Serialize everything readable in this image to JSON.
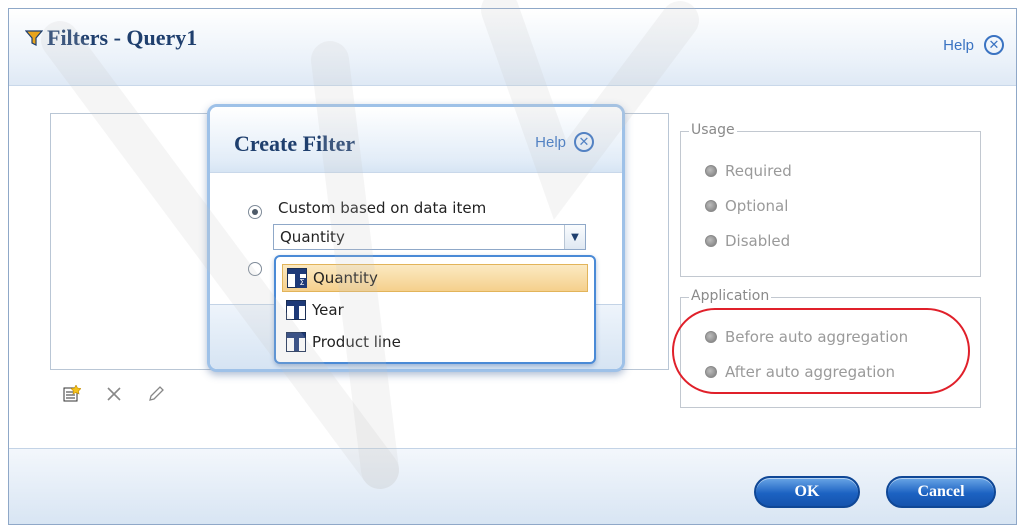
{
  "outer": {
    "title": "Filters - Query1",
    "help": "Help",
    "usage": {
      "legend": "Usage",
      "options": [
        "Required",
        "Optional",
        "Disabled"
      ]
    },
    "application": {
      "legend": "Application",
      "options": [
        "Before auto aggregation",
        "After auto aggregation"
      ]
    },
    "ok": "OK",
    "cancel": "Cancel"
  },
  "create_filter": {
    "title": "Create Filter",
    "help": "Help",
    "custom_label": "Custom based on data item",
    "selected_item": "Quantity",
    "dropdown": [
      "Quantity",
      "Year",
      "Product line"
    ]
  },
  "colors": {
    "accent": "#1f3f6e",
    "link": "#3a73c2",
    "highlight_oval": "#e0202a"
  },
  "icons": [
    "filter-icon",
    "close-icon",
    "new-filter-icon",
    "delete-icon",
    "edit-icon",
    "measure-icon",
    "column-icon",
    "chevron-down-icon"
  ]
}
